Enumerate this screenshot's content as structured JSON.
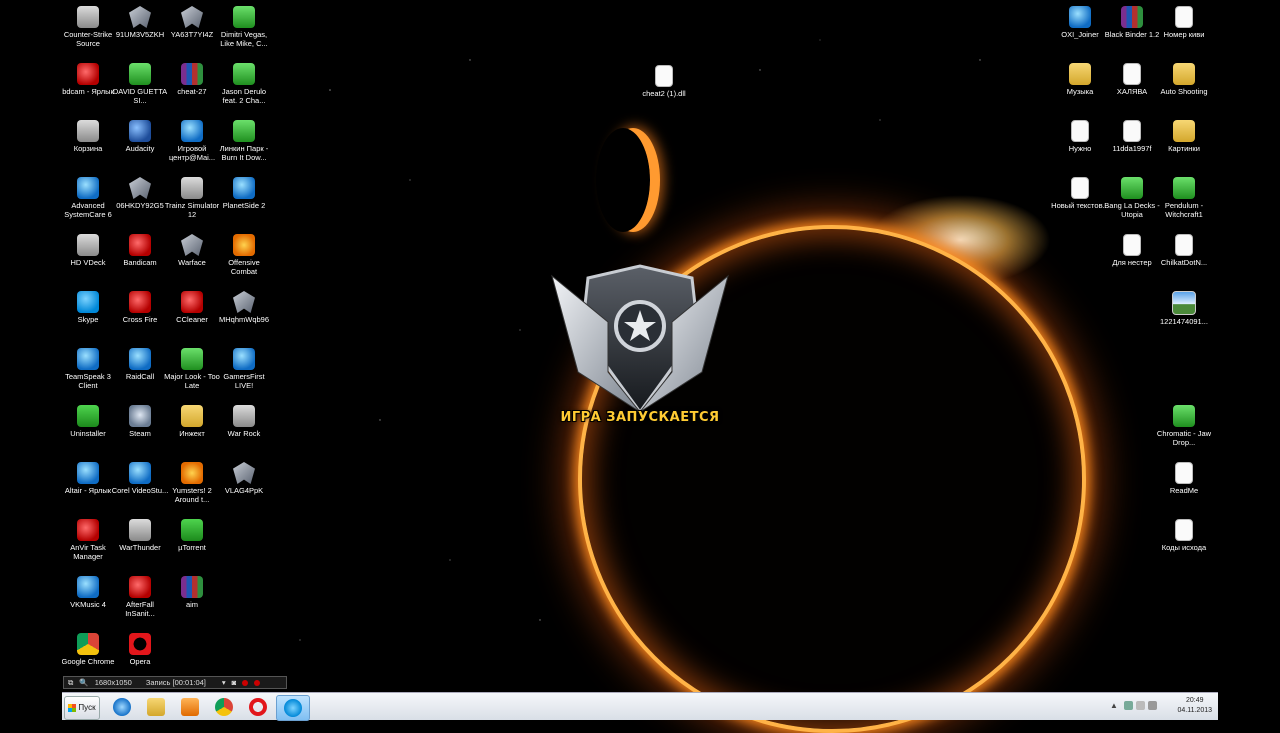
{
  "desktop": {
    "left_icons": [
      {
        "label": "Counter-Strike Source",
        "icon": "counter-strike-icon",
        "col": 0,
        "row": 0,
        "style": "ic-gray"
      },
      {
        "label": "91UM3V5ZKH",
        "icon": "warface-wing-icon",
        "col": 1,
        "row": 0,
        "style": "ic-wing"
      },
      {
        "label": "YA63T7YI4Z",
        "icon": "warface-wing-icon",
        "col": 2,
        "row": 0,
        "style": "ic-wing"
      },
      {
        "label": "Dimitri Vegas, Like Mike, C...",
        "icon": "mp3-file-icon",
        "col": 3,
        "row": 0,
        "style": "ic-mp3"
      },
      {
        "label": "bdcam - Ярлык",
        "icon": "bandicam-shortcut-icon",
        "col": 0,
        "row": 1,
        "style": "ic-red"
      },
      {
        "label": "DAVID GUETTA SI...",
        "icon": "mp3-file-icon",
        "col": 1,
        "row": 1,
        "style": "ic-mp3"
      },
      {
        "label": "cheat-27",
        "icon": "winrar-archive-icon",
        "col": 2,
        "row": 1,
        "style": "ic-winrar"
      },
      {
        "label": "Jason Derulo feat. 2 Cha...",
        "icon": "mp3-file-icon",
        "col": 3,
        "row": 1,
        "style": "ic-mp3"
      },
      {
        "label": "Корзина",
        "icon": "recycle-bin-icon",
        "col": 0,
        "row": 2,
        "style": "ic-gray"
      },
      {
        "label": "Audacity",
        "icon": "audacity-icon",
        "col": 1,
        "row": 2,
        "style": "ic-audio"
      },
      {
        "label": "Игровой центр@Mai...",
        "icon": "game-center-icon",
        "col": 2,
        "row": 2,
        "style": "ic-blue"
      },
      {
        "label": "Линкин Парк - Burn It Dow...",
        "icon": "mp3-file-icon",
        "col": 3,
        "row": 2,
        "style": "ic-mp3"
      },
      {
        "label": "Advanced SystemCare 6",
        "icon": "systemcare-icon",
        "col": 0,
        "row": 3,
        "style": "ic-blue"
      },
      {
        "label": "06HKDY92G5",
        "icon": "warface-wing-icon",
        "col": 1,
        "row": 3,
        "style": "ic-wing"
      },
      {
        "label": "Trainz Simulator 12",
        "icon": "trainz-icon",
        "col": 2,
        "row": 3,
        "style": "ic-gray"
      },
      {
        "label": "PlanetSide 2",
        "icon": "planetside-icon",
        "col": 3,
        "row": 3,
        "style": "ic-blue"
      },
      {
        "label": "HD VDeck",
        "icon": "hd-vdeck-icon",
        "col": 0,
        "row": 4,
        "style": "ic-gray"
      },
      {
        "label": "Bandicam",
        "icon": "bandicam-icon",
        "col": 1,
        "row": 4,
        "style": "ic-red"
      },
      {
        "label": "Warface",
        "icon": "warface-icon",
        "col": 2,
        "row": 4,
        "style": "ic-wing"
      },
      {
        "label": "Offensive Combat",
        "icon": "offensive-combat-icon",
        "col": 3,
        "row": 4,
        "style": "ic-orange"
      },
      {
        "label": "Skype",
        "icon": "skype-icon",
        "col": 0,
        "row": 5,
        "style": "ic-skype"
      },
      {
        "label": "Cross Fire",
        "icon": "crossfire-icon",
        "col": 1,
        "row": 5,
        "style": "ic-red"
      },
      {
        "label": "CCleaner",
        "icon": "ccleaner-icon",
        "col": 2,
        "row": 5,
        "style": "ic-red"
      },
      {
        "label": "MHqhmWqb96",
        "icon": "warface-wing-icon",
        "col": 3,
        "row": 5,
        "style": "ic-wing"
      },
      {
        "label": "TeamSpeak 3 Client",
        "icon": "teamspeak-icon",
        "col": 0,
        "row": 6,
        "style": "ic-blue"
      },
      {
        "label": "RaidCall",
        "icon": "raidcall-icon",
        "col": 1,
        "row": 6,
        "style": "ic-blue"
      },
      {
        "label": "Major Look - Too Late",
        "icon": "mp3-file-icon",
        "col": 2,
        "row": 6,
        "style": "ic-mp3"
      },
      {
        "label": "GamersFirst LIVE!",
        "icon": "gamersfirst-icon",
        "col": 3,
        "row": 6,
        "style": "ic-blue"
      },
      {
        "label": "Uninstaller",
        "icon": "uninstaller-icon",
        "col": 0,
        "row": 7,
        "style": "ic-green"
      },
      {
        "label": "Steam",
        "icon": "steam-icon",
        "col": 1,
        "row": 7,
        "style": "ic-steam"
      },
      {
        "label": "Инжект",
        "icon": "folder-icon",
        "col": 2,
        "row": 7,
        "style": "ic-folder"
      },
      {
        "label": "War Rock",
        "icon": "war-rock-icon",
        "col": 3,
        "row": 7,
        "style": "ic-gray"
      },
      {
        "label": "Altair - Ярлык",
        "icon": "altair-shortcut-icon",
        "col": 0,
        "row": 8,
        "style": "ic-blue"
      },
      {
        "label": "Corel VideoStu...",
        "icon": "corel-icon",
        "col": 1,
        "row": 8,
        "style": "ic-blue"
      },
      {
        "label": "Yumsters! 2 Around t...",
        "icon": "yumsters-icon",
        "col": 2,
        "row": 8,
        "style": "ic-orange"
      },
      {
        "label": "VLAG4PpK",
        "icon": "warface-wing-icon",
        "col": 3,
        "row": 8,
        "style": "ic-wing"
      },
      {
        "label": "AnVir Task Manager",
        "icon": "anvir-icon",
        "col": 0,
        "row": 9,
        "style": "ic-red"
      },
      {
        "label": "WarThunder",
        "icon": "warthunder-icon",
        "col": 1,
        "row": 9,
        "style": "ic-gray"
      },
      {
        "label": "µTorrent",
        "icon": "utorrent-icon",
        "col": 2,
        "row": 9,
        "style": "ic-green"
      },
      {
        "label": "VKMusic 4",
        "icon": "vkmusic-icon",
        "col": 0,
        "row": 10,
        "style": "ic-blue"
      },
      {
        "label": "AfterFall InSanit...",
        "icon": "afterfall-icon",
        "col": 1,
        "row": 10,
        "style": "ic-red"
      },
      {
        "label": "aim",
        "icon": "winrar-archive-icon",
        "col": 2,
        "row": 10,
        "style": "ic-winrar"
      },
      {
        "label": "Google Chrome",
        "icon": "chrome-icon",
        "col": 0,
        "row": 11,
        "style": "ic-chrome"
      },
      {
        "label": "Opera",
        "icon": "opera-icon",
        "col": 1,
        "row": 11,
        "style": "ic-opera"
      }
    ],
    "right_icons": [
      {
        "label": "OXI_Joiner",
        "icon": "oxi-joiner-icon",
        "col": 0,
        "row": 0,
        "style": "ic-blue"
      },
      {
        "label": "Black Binder 1.2",
        "icon": "winrar-archive-icon",
        "col": 1,
        "row": 0,
        "style": "ic-winrar"
      },
      {
        "label": "Номер киви",
        "icon": "text-file-icon",
        "col": 2,
        "row": 0,
        "style": "ic-doc"
      },
      {
        "label": "Музыка",
        "icon": "folder-icon",
        "col": 0,
        "row": 1,
        "style": "ic-folder"
      },
      {
        "label": "ХАЛЯВА",
        "icon": "text-file-icon",
        "col": 1,
        "row": 1,
        "style": "ic-doc"
      },
      {
        "label": "Auto Shooting",
        "icon": "folder-icon",
        "col": 2,
        "row": 1,
        "style": "ic-folder"
      },
      {
        "label": "Нужно",
        "icon": "text-file-icon",
        "col": 0,
        "row": 2,
        "style": "ic-doc"
      },
      {
        "label": "11dda1997f",
        "icon": "text-file-icon",
        "col": 1,
        "row": 2,
        "style": "ic-doc"
      },
      {
        "label": "Картинки",
        "icon": "folder-icon",
        "col": 2,
        "row": 2,
        "style": "ic-folder"
      },
      {
        "label": "Новый текстов...",
        "icon": "text-file-icon",
        "col": 0,
        "row": 3,
        "style": "ic-doc"
      },
      {
        "label": "Bang La Decks - Utopia",
        "icon": "mp3-file-icon",
        "col": 1,
        "row": 3,
        "style": "ic-mp3"
      },
      {
        "label": "Pendulum - Witchcraft1",
        "icon": "mp3-file-icon",
        "col": 2,
        "row": 3,
        "style": "ic-mp3"
      },
      {
        "label": "Для нестер",
        "icon": "document-file-icon",
        "col": 1,
        "row": 4,
        "style": "ic-doc"
      },
      {
        "label": "ChilkatDotN...",
        "icon": "dll-file-icon",
        "col": 2,
        "row": 4,
        "style": "ic-doc"
      },
      {
        "label": "1221474091...",
        "icon": "image-file-icon",
        "col": 2,
        "row": 5,
        "style": "ic-img"
      },
      {
        "label": "Chromatic - Jaw Drop...",
        "icon": "mp3-file-icon",
        "col": 2,
        "row": 7,
        "style": "ic-mp3"
      },
      {
        "label": "ReadMe",
        "icon": "text-file-icon",
        "col": 2,
        "row": 8,
        "style": "ic-doc"
      },
      {
        "label": "Коды исхода",
        "icon": "text-file-icon",
        "col": 2,
        "row": 9,
        "style": "ic-doc"
      }
    ],
    "center_icon": {
      "label": "cheat2 (1).dll",
      "icon": "dll-file-icon"
    }
  },
  "splash": {
    "text": "ИГРА ЗАПУСКАЕТСЯ",
    "logo": "warface-emblem-icon"
  },
  "recorder": {
    "resolution": "1680x1050",
    "status": "Запись [00:01:04]"
  },
  "taskbar": {
    "start_label": "Пуск",
    "pinned": [
      {
        "name": "internet-explorer",
        "icon": "ie-icon"
      },
      {
        "name": "explorer",
        "icon": "folder-icon"
      },
      {
        "name": "media-player",
        "icon": "media-player-icon"
      },
      {
        "name": "chrome",
        "icon": "chrome-icon"
      },
      {
        "name": "opera",
        "icon": "opera-icon"
      },
      {
        "name": "skype",
        "icon": "skype-icon"
      }
    ],
    "clock_time": "20:49",
    "clock_date": "04.11.2013"
  }
}
